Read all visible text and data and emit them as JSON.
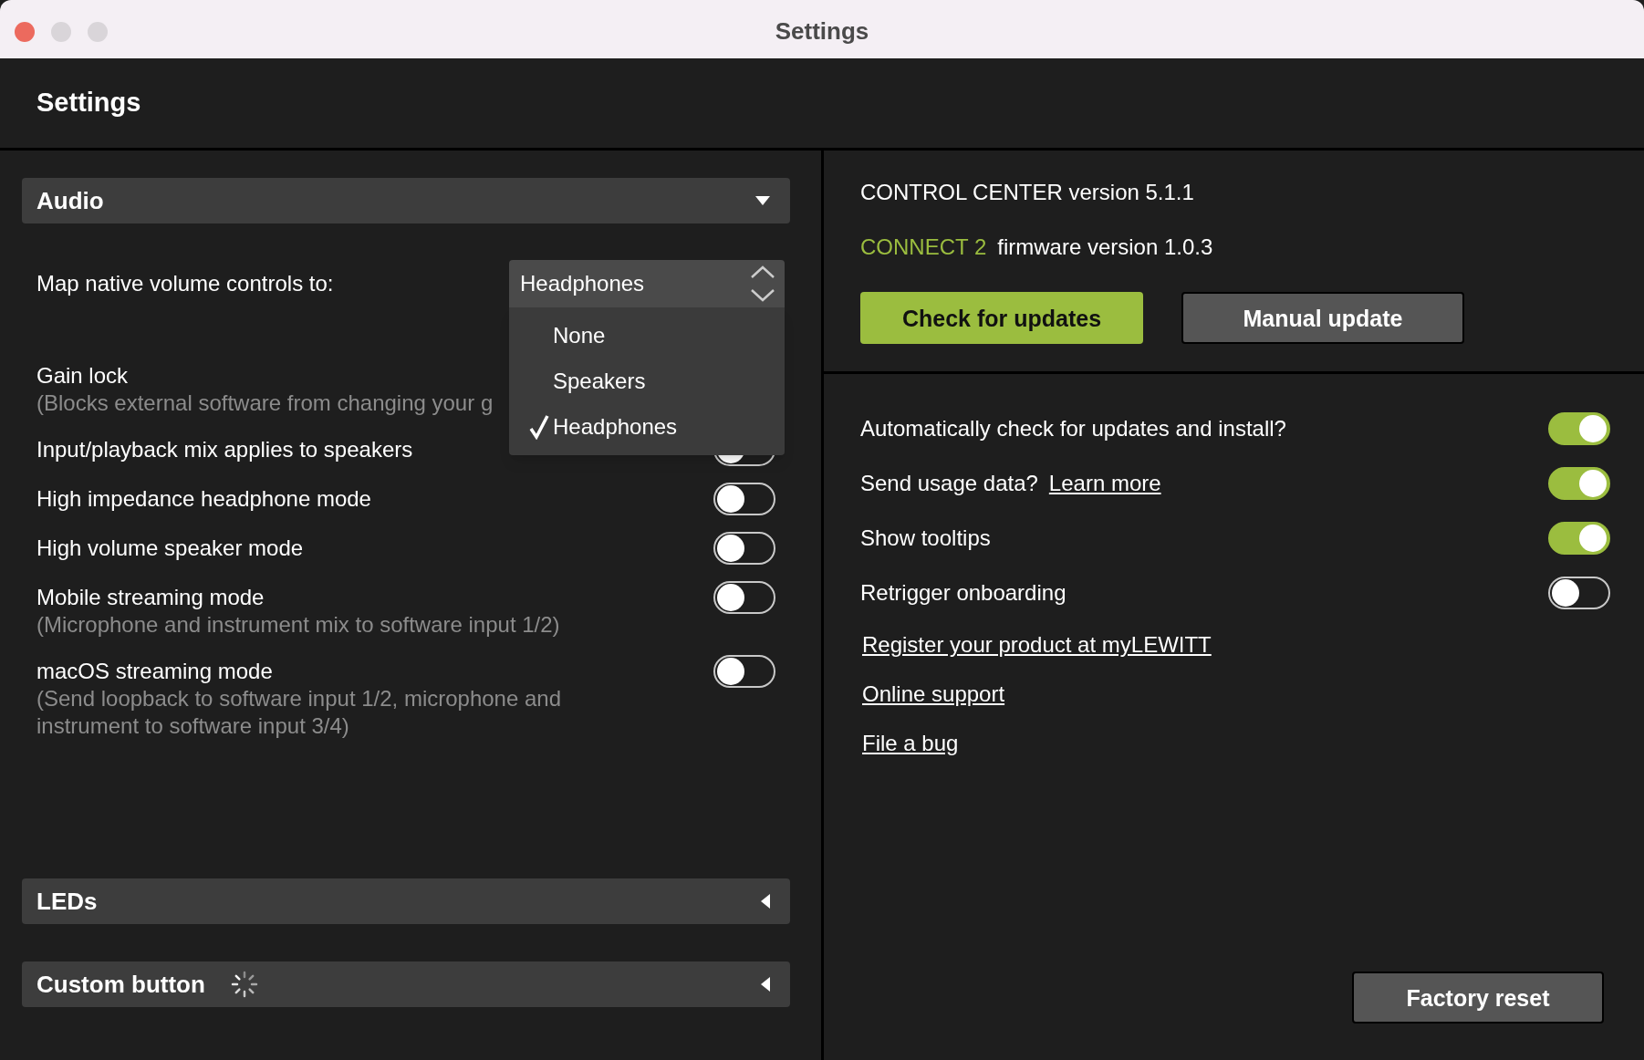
{
  "window": {
    "title": "Settings"
  },
  "header": {
    "title": "Settings"
  },
  "audio": {
    "title": "Audio",
    "expanded": true,
    "volume_mapping": {
      "label": "Map native volume controls to:",
      "value": "Headphones",
      "open": true,
      "options": [
        {
          "label": "None",
          "selected": false
        },
        {
          "label": "Speakers",
          "selected": false
        },
        {
          "label": "Headphones",
          "selected": true
        }
      ]
    },
    "settings": [
      {
        "kind": "covered",
        "label": "Gain lock",
        "note": "(Blocks external software from changing your g"
      },
      {
        "kind": "toggle",
        "label": "Input/playback mix applies to speakers",
        "on": false
      },
      {
        "kind": "toggle",
        "label": "High impedance headphone mode",
        "on": false
      },
      {
        "kind": "toggle",
        "label": "High volume speaker mode",
        "on": false
      },
      {
        "kind": "toggle",
        "label": "Mobile streaming mode",
        "note": "(Microphone and instrument mix to software input 1/2)",
        "on": false
      },
      {
        "kind": "toggle",
        "label": "macOS streaming mode",
        "note": "(Send loopback to software input 1/2, microphone and instrument to software input 3/4)",
        "on": false
      }
    ]
  },
  "collapsed_sections": [
    {
      "title": "LEDs",
      "expanded": false,
      "busy": false
    },
    {
      "title": "Custom button",
      "expanded": false,
      "busy": true
    }
  ],
  "versions": {
    "app": "CONTROL CENTER version 5.1.1",
    "device": "CONNECT 2",
    "firmware": "firmware version 1.0.3"
  },
  "update_buttons": [
    {
      "label": "Check for updates",
      "kind": "primary"
    },
    {
      "label": "Manual update",
      "kind": "secondary"
    }
  ],
  "preferences": [
    {
      "label": "Automatically check for updates and install?",
      "on": true
    },
    {
      "label": "Send usage data?",
      "link": "Learn more",
      "on": true
    },
    {
      "label": "Show tooltips",
      "on": true
    },
    {
      "label": "Retrigger onboarding",
      "on": false
    }
  ],
  "links": [
    "Register your product at myLEWITT",
    "Online support",
    "File a bug"
  ],
  "factory_reset": {
    "label": "Factory reset"
  }
}
